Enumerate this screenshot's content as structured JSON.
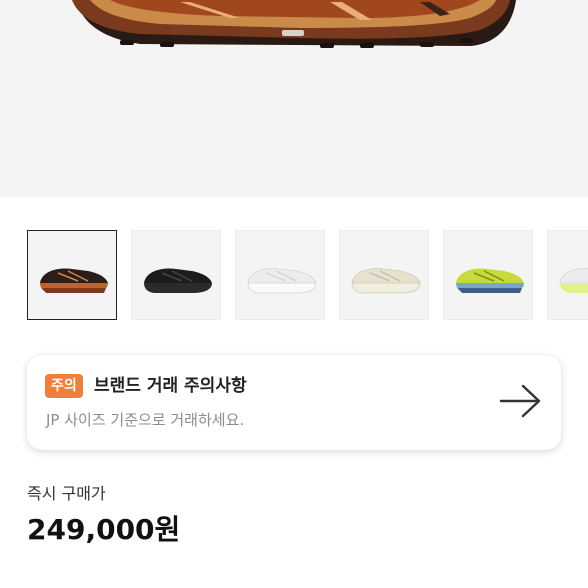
{
  "product": {
    "hero_image": "sneaker-hero-image",
    "thumbnails": [
      {
        "name": "thumbnail-brown-orange",
        "selected": true
      },
      {
        "name": "thumbnail-black",
        "selected": false
      },
      {
        "name": "thumbnail-white",
        "selected": false
      },
      {
        "name": "thumbnail-cream",
        "selected": false
      },
      {
        "name": "thumbnail-lime",
        "selected": false
      },
      {
        "name": "thumbnail-white-partial",
        "selected": false
      }
    ]
  },
  "notice": {
    "badge": "주의",
    "title": "브랜드 거래 주의사항",
    "description": "JP 사이즈 기준으로 거래하세요.",
    "arrow_icon": "arrow-right-icon",
    "badge_color": "#f07f3c"
  },
  "purchase": {
    "label": "즉시 구매가",
    "price": "249,000원"
  }
}
